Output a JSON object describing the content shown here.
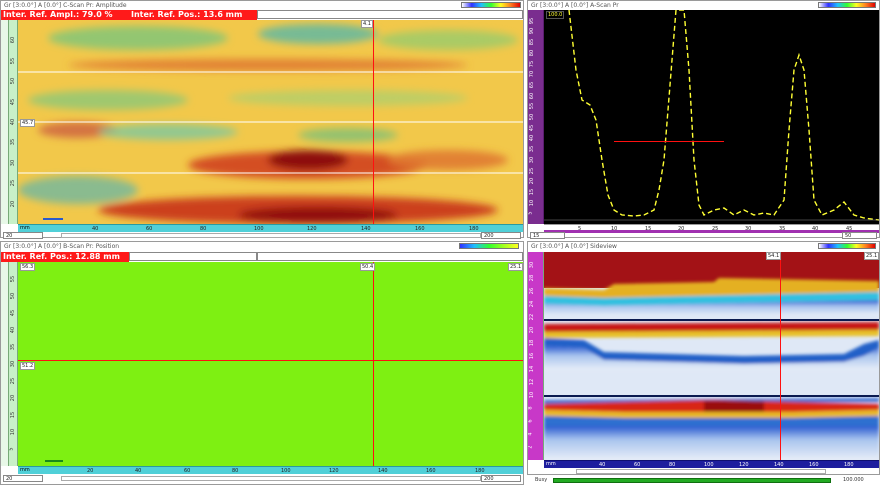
{
  "cscan": {
    "title": "Gr [3:0.0°] A [0.0°] C-Scan Pr: Amplitude",
    "ampl_readout": "Inter. Ref. Ampl.: 79.0 %",
    "pos_readout": "Inter. Ref. Pos.: 13.6 mm",
    "cursor_label": "4.1",
    "left_marker": "45.7",
    "y_ticks": [
      "60",
      "55",
      "50",
      "45",
      "40",
      "35",
      "30",
      "25",
      "20"
    ],
    "x_ticks": [
      "40",
      "60",
      "80",
      "100",
      "120",
      "140",
      "160",
      "180"
    ],
    "x_unit": "mm",
    "axis_input": "20",
    "axis_input_right": "200"
  },
  "ascan": {
    "title": "Gr [3:0.0°] A [0.0°] A-Scan Pr",
    "top_value": "100.0",
    "y_ticks": [
      "95",
      "90",
      "85",
      "80",
      "75",
      "70",
      "65",
      "60",
      "55",
      "50",
      "45",
      "40",
      "35",
      "30",
      "25",
      "20",
      "15",
      "10",
      "5"
    ],
    "x_ticks": [
      "5",
      "10",
      "15",
      "20",
      "25",
      "30",
      "35",
      "40",
      "45"
    ],
    "axis_input": "15",
    "axis_input_right": "50"
  },
  "bscan": {
    "title": "Gr [3:0.0°] A [0.0°] B-Scan Pr: Position",
    "pos_readout": "Inter. Ref. Pos.: 12.88 mm",
    "top_left_label": "56.3",
    "cursor_label": "50.4",
    "right_label": "25.1",
    "mid_label": "51.2",
    "y_ticks": [
      "55",
      "50",
      "45",
      "40",
      "35",
      "30",
      "25",
      "20",
      "15",
      "10",
      "5"
    ],
    "x_ticks": [
      "20",
      "40",
      "60",
      "80",
      "100",
      "120",
      "140",
      "160",
      "180"
    ],
    "x_unit": "mm",
    "axis_input": "20",
    "axis_input_right": "200"
  },
  "sscan": {
    "title": "Gr [3:0.0°] A [0.0°] Sideview",
    "cursor_label": "54.1",
    "right_label": "25.1",
    "y_ticks": [
      "30",
      "28",
      "26",
      "24",
      "22",
      "20",
      "18",
      "16",
      "14",
      "12",
      "10",
      "8",
      "6",
      "4",
      "2"
    ],
    "x_ticks": [
      "40",
      "60",
      "80",
      "100",
      "120",
      "140",
      "160",
      "180"
    ],
    "x_unit": "mm"
  },
  "status": {
    "left": "Busy",
    "right": "100.000"
  },
  "colors": {
    "cursor": "#ff1010",
    "bscan_fill": "#7ef012",
    "ascan_bg": "#000000",
    "ascan_trace": "#ffff33",
    "readout_bg": "#ff1a1a"
  }
}
